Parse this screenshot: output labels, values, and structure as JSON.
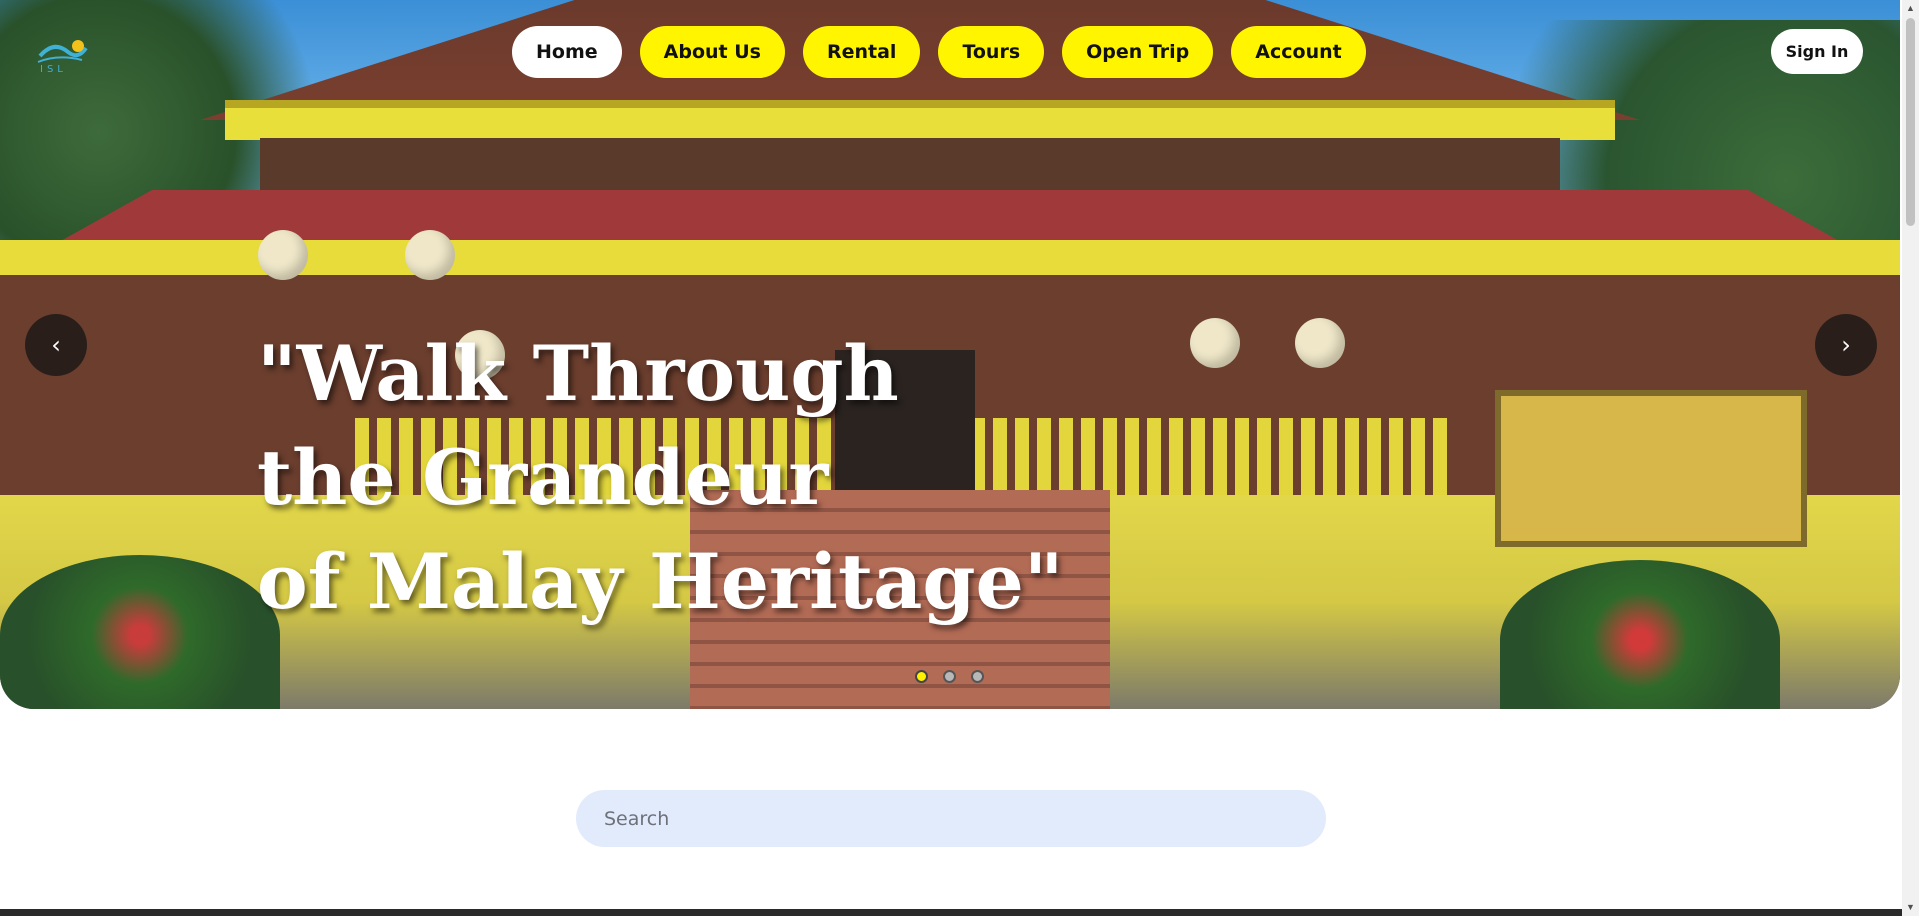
{
  "brand": {
    "logo_text": "ISL"
  },
  "nav": {
    "items": [
      {
        "label": "Home",
        "active": true
      },
      {
        "label": "About Us",
        "active": false
      },
      {
        "label": "Rental",
        "active": false
      },
      {
        "label": "Tours",
        "active": false
      },
      {
        "label": "Open Trip",
        "active": false
      },
      {
        "label": "Account",
        "active": false
      }
    ],
    "sign_in_label": "Sign In"
  },
  "hero": {
    "headline_lines": [
      "\"Walk Through",
      "the Grandeur",
      "of Malay Heritage\""
    ],
    "prev_icon": "‹",
    "next_icon": "›",
    "slides_count": 3,
    "active_slide": 1
  },
  "search": {
    "placeholder": "Search",
    "value": ""
  },
  "colors": {
    "accent": "#fff500",
    "search_bg": "#e1ebfc"
  }
}
